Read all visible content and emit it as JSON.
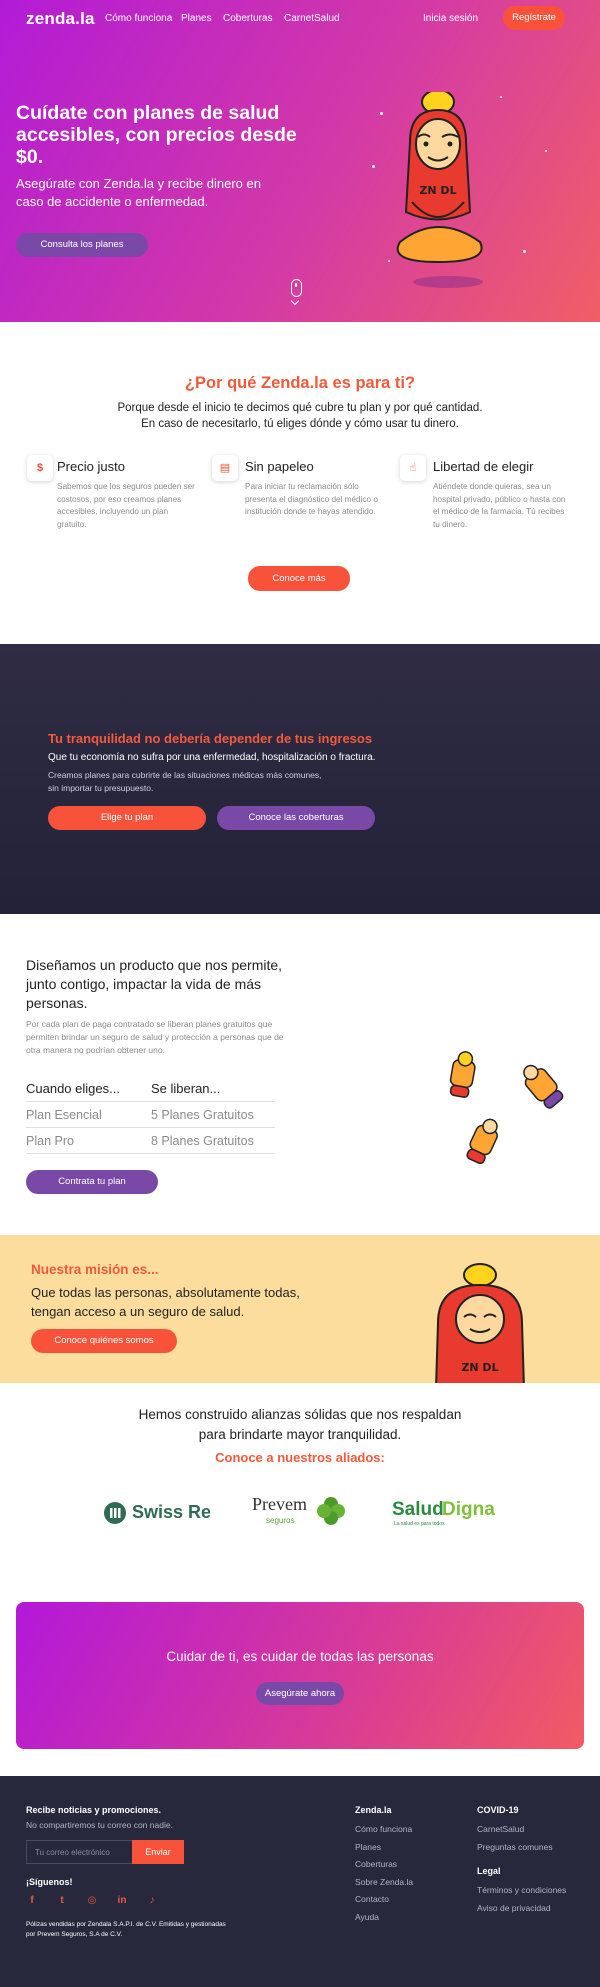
{
  "nav": {
    "logo": "zenda.la",
    "links": [
      "Cómo funciona",
      "Planes",
      "Coberturas",
      "CarnetSalud"
    ],
    "login": "Inicia sesión",
    "register": "Regístrate"
  },
  "hero": {
    "title": "Cuídate con planes de salud accesibles, con precios desde $0.",
    "subtitle": "Asegúrate con Zenda.la y recibe dinero en caso de accidente o enfermedad.",
    "cta": "Consulta los planes",
    "mascot_label": "ZN DL"
  },
  "why": {
    "title": "¿Por qué Zenda.la es para ti?",
    "line1": "Porque desde el inicio te decimos qué cubre tu plan y por qué cantidad.",
    "line2": "En caso de necesitarlo, tú eliges dónde y cómo usar tu dinero.",
    "features": [
      {
        "title": "Precio justo",
        "text": "Sabemos que los seguros pueden ser costosos, por eso creamos planes accesibles, incluyendo un plan gratuito."
      },
      {
        "title": "Sin papeleo",
        "text": "Para iniciar tu reclamación sólo presenta el diagnóstico del médico o institución donde te hayas atendido."
      },
      {
        "title": "Libertad de elegir",
        "text": "Atiéndete donde quieras, sea un hospital privado, público o hasta con el médico de la farmacia. Tú recibes tu dinero."
      }
    ],
    "cta": "Conoce más"
  },
  "peace": {
    "title": "Tu tranquilidad no debería depender de tus ingresos",
    "subtitle": "Que tu economía no sufra por una enfermedad, hospitalización o fractura.",
    "text1": "Creamos planes para cubrirte de las situaciones médicas más comunes,",
    "text2": "sin importar tu presupuesto.",
    "btn1": "Elige tu plan",
    "btn2": "Conoce las coberturas"
  },
  "product": {
    "title": "Diseñamos un producto que nos permite, junto contigo, impactar la vida de más personas.",
    "text": "Por cada plan de paga contratado se liberan planes gratuitos que permiten brindar un seguro de salud y protección a personas que de otra manera no podrían obtener uno.",
    "col1": "Cuando eliges...",
    "col2": "Se liberan...",
    "rows": [
      {
        "plan": "Plan Esencial",
        "free": "5 Planes Gratuitos"
      },
      {
        "plan": "Plan Pro",
        "free": "8 Planes Gratuitos"
      }
    ],
    "cta": "Contrata tu plan"
  },
  "mission": {
    "title": "Nuestra misión es...",
    "text": "Que todas las personas, absolutamente todas, tengan acceso a un seguro de salud.",
    "cta": "Conoce quiénes somos"
  },
  "allies": {
    "line1": "Hemos construido alianzas sólidas que nos respaldan",
    "line2": "para brindarte mayor tranquilidad.",
    "subtitle": "Conoce a nuestros aliados:",
    "logos": {
      "swiss": "Swiss Re",
      "prevem": "Prevem",
      "prevem_sub": "seguros",
      "salud1": "Salud",
      "salud2": "Digna",
      "salud_tag": "La salud es para todos"
    }
  },
  "cta": {
    "text": "Cuidar de ti, es cuidar de todas las personas",
    "button": "Asegúrate ahora"
  },
  "footer": {
    "news_title": "Recibe noticias y promociones.",
    "news_sub": "No compartiremos tu correo con nadie.",
    "email_placeholder": "Tu correo electrónico",
    "send": "Enviar",
    "follow": "¡Síguenos!",
    "social": {
      "facebook": "f",
      "twitter": "t",
      "instagram": "◎",
      "linkedin": "in",
      "tiktok": "♪"
    },
    "legal_note1": "Pólizas vendidas por Zendala S.A.P.I. de C.V. Emitidas y gestionadas",
    "legal_note2": "por Prevem Seguros, S.A de C.V.",
    "col1_title": "Zenda.la",
    "col1_links": [
      "Cómo funciona",
      "Planes",
      "Coberturas",
      "Sobre Zenda.la",
      "Contacto",
      "Ayuda"
    ],
    "col2_title": "COVID-19",
    "col2_links": [
      "CarnetSalud",
      "Preguntas comunes"
    ],
    "legal_title": "Legal",
    "legal_links": [
      "Términos y condiciones",
      "Aviso de privacidad"
    ]
  },
  "colors": {
    "brand_orange": "#f8533a",
    "brand_purple": "#7a49a8",
    "dark_bg": "#28283d",
    "mission_bg": "#fcdd9e"
  }
}
